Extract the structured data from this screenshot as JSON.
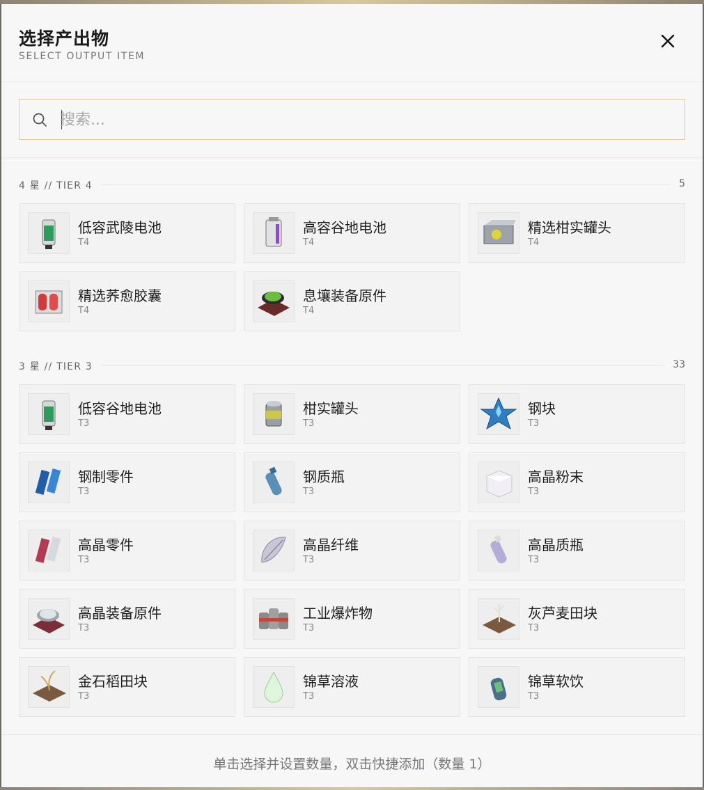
{
  "dialog": {
    "title": "选择产出物",
    "subtitle": "SELECT OUTPUT ITEM"
  },
  "search": {
    "placeholder": "搜索...",
    "value": ""
  },
  "sections": [
    {
      "label": "4 星 // TIER 4",
      "count": "5",
      "items": [
        {
          "name": "低容武陵电池",
          "tier": "T4",
          "icon": "battery-green-icon"
        },
        {
          "name": "高容谷地电池",
          "tier": "T4",
          "icon": "battery-purple-icon"
        },
        {
          "name": "精选柑实罐头",
          "tier": "T4",
          "icon": "tin-can-box-icon"
        },
        {
          "name": "精选荞愈胶囊",
          "tier": "T4",
          "icon": "capsule-box-icon"
        },
        {
          "name": "息壤装备原件",
          "tier": "T4",
          "icon": "equipment-disc-icon"
        }
      ]
    },
    {
      "label": "3 星 // TIER 3",
      "count": "33",
      "items": [
        {
          "name": "低容谷地电池",
          "tier": "T3",
          "icon": "battery-green-icon"
        },
        {
          "name": "柑实罐头",
          "tier": "T3",
          "icon": "tin-can-icon"
        },
        {
          "name": "钢块",
          "tier": "T3",
          "icon": "steel-crystal-icon"
        },
        {
          "name": "钢制零件",
          "tier": "T3",
          "icon": "steel-parts-icon"
        },
        {
          "name": "钢质瓶",
          "tier": "T3",
          "icon": "steel-bottle-icon"
        },
        {
          "name": "高晶粉末",
          "tier": "T3",
          "icon": "crystal-powder-icon"
        },
        {
          "name": "高晶零件",
          "tier": "T3",
          "icon": "crystal-parts-icon"
        },
        {
          "name": "高晶纤维",
          "tier": "T3",
          "icon": "crystal-fiber-icon"
        },
        {
          "name": "高晶质瓶",
          "tier": "T3",
          "icon": "crystal-bottle-icon"
        },
        {
          "name": "高晶装备原件",
          "tier": "T3",
          "icon": "crystal-equipment-icon"
        },
        {
          "name": "工业爆炸物",
          "tier": "T3",
          "icon": "explosive-cans-icon"
        },
        {
          "name": "灰芦麦田块",
          "tier": "T3",
          "icon": "wheat-plot-icon"
        },
        {
          "name": "金石稻田块",
          "tier": "T3",
          "icon": "rice-plot-icon"
        },
        {
          "name": "锦草溶液",
          "tier": "T3",
          "icon": "herb-droplet-icon"
        },
        {
          "name": "锦草软饮",
          "tier": "T3",
          "icon": "herb-drink-icon"
        }
      ]
    }
  ],
  "footer": {
    "hint": "单击选择并设置数量，双击快捷添加（数量 1）"
  }
}
